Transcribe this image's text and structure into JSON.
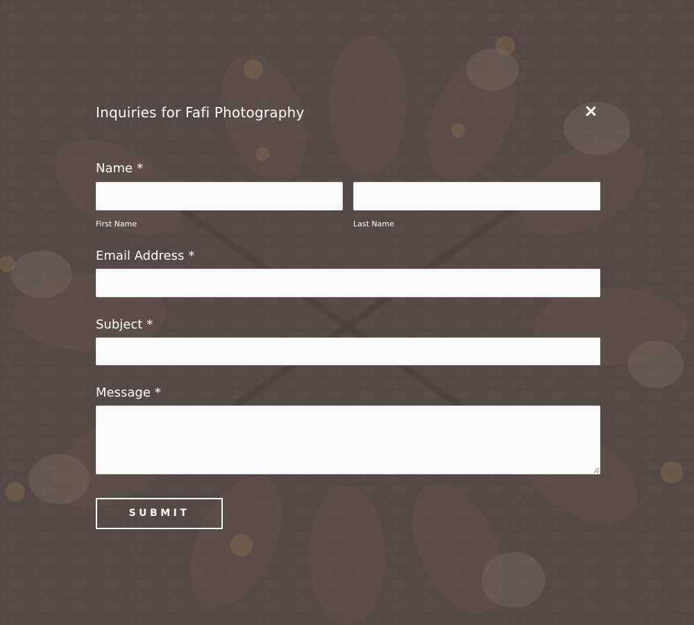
{
  "form": {
    "title": "Inquiries for Fafi Photography",
    "name": {
      "label": "Name",
      "required_mark": "*",
      "first_sublabel": "First Name",
      "last_sublabel": "Last Name",
      "first_value": "",
      "last_value": ""
    },
    "email": {
      "label": "Email Address",
      "required_mark": "*",
      "value": ""
    },
    "subject": {
      "label": "Subject",
      "required_mark": "*",
      "value": ""
    },
    "message": {
      "label": "Message",
      "required_mark": "*",
      "value": ""
    },
    "submit_label": "SUBMIT"
  },
  "icons": {
    "close": "close-icon"
  },
  "colors": {
    "overlay": "#4b403e",
    "text": "#ffffff",
    "field_background": "#fafafa"
  }
}
